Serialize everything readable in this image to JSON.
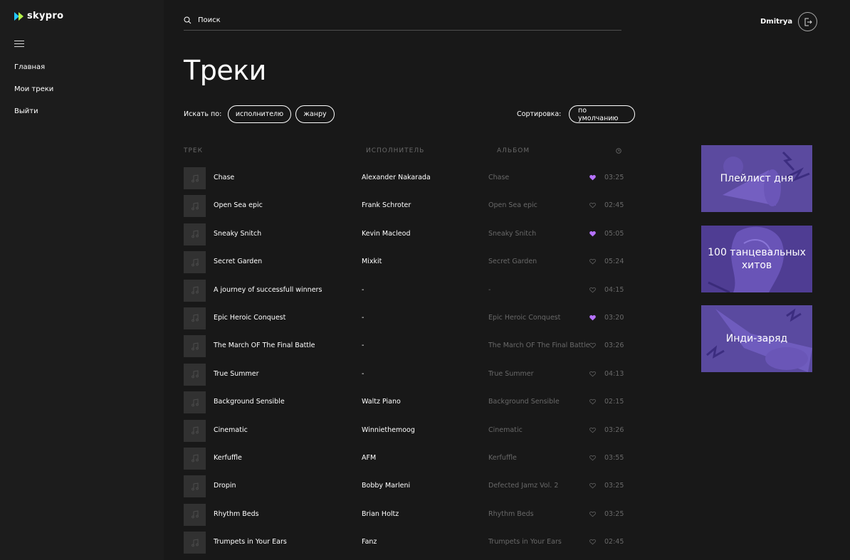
{
  "app": {
    "brand": "skypro",
    "accent": "#b672ff",
    "logo_colors": [
      "#23c8ff",
      "#c4ff4d"
    ]
  },
  "sidebar": {
    "items": [
      {
        "label": "Главная"
      },
      {
        "label": "Мои треки"
      },
      {
        "label": "Выйти"
      }
    ]
  },
  "search": {
    "placeholder": "Поиск"
  },
  "user": {
    "name": "Dmitrya"
  },
  "page": {
    "title": "Треки"
  },
  "filters": {
    "label": "Искать по:",
    "options": [
      "исполнителю",
      "жанру"
    ],
    "sort_label": "Сортировка:",
    "sort_value": "по умолчанию"
  },
  "table": {
    "headers": {
      "track": "ТРЕК",
      "artist": "ИСПОЛНИТЕЛЬ",
      "album": "АЛЬБОМ",
      "time_icon": "clock-icon"
    },
    "rows": [
      {
        "title": "Chase",
        "artist": "Alexander Nakarada",
        "album": "Chase",
        "liked": true,
        "time": "03:25"
      },
      {
        "title": "Open Sea epic",
        "artist": "Frank Schroter",
        "album": "Open Sea epic",
        "liked": false,
        "time": "02:45"
      },
      {
        "title": "Sneaky Snitch",
        "artist": "Kevin Macleod",
        "album": "Sneaky Snitch",
        "liked": true,
        "time": "05:05"
      },
      {
        "title": "Secret Garden",
        "artist": "Mixkit",
        "album": "Secret Garden",
        "liked": false,
        "time": "05:24"
      },
      {
        "title": "A journey of successfull winners",
        "artist": "-",
        "album": "-",
        "liked": false,
        "time": "04:15"
      },
      {
        "title": "Epic Heroic Conquest",
        "artist": "-",
        "album": "Epic Heroic Conquest",
        "liked": true,
        "time": "03:20"
      },
      {
        "title": "The March OF The Final Battle",
        "artist": "-",
        "album": "The March OF The Final Battle",
        "liked": false,
        "time": "03:26"
      },
      {
        "title": "True Summer",
        "artist": "-",
        "album": "True Summer",
        "liked": false,
        "time": "04:13"
      },
      {
        "title": "Background Sensible",
        "artist": "Waltz Piano",
        "album": "Background Sensible",
        "liked": false,
        "time": "02:15"
      },
      {
        "title": "Cinematic",
        "artist": "Winniethemoog",
        "album": "Cinematic",
        "liked": false,
        "time": "03:26"
      },
      {
        "title": "Kerfuffle",
        "artist": "AFM",
        "album": "Kerfuffle",
        "liked": false,
        "time": "03:55"
      },
      {
        "title": "Dropin",
        "artist": "Bobby Marleni",
        "album": "Defected Jamz Vol. 2",
        "liked": false,
        "time": "03:25"
      },
      {
        "title": "Rhythm Beds",
        "artist": "Brian Holtz",
        "album": "Rhythm Beds",
        "liked": false,
        "time": "03:25"
      },
      {
        "title": "Trumpets in Your Ears",
        "artist": "Fanz",
        "album": "Trumpets in Your Ears",
        "liked": false,
        "time": "02:45"
      }
    ]
  },
  "playlists": [
    {
      "label": "Плейлист дня",
      "color": "#5b4a9f"
    },
    {
      "label": "100 танцевальных хитов",
      "color": "#4f3d93"
    },
    {
      "label": "Инди-заряд",
      "color": "#5a4aa0"
    }
  ]
}
